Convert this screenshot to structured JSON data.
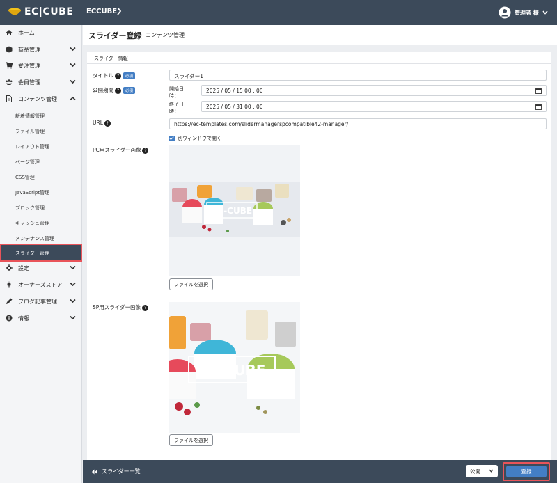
{
  "header": {
    "logo_text": "EC|CUBE",
    "site_name": "ECCUBE",
    "user_name": "管理者 様"
  },
  "sidebar": {
    "items": [
      {
        "label": "ホーム",
        "icon": "home-icon"
      },
      {
        "label": "商品管理",
        "icon": "cube-icon"
      },
      {
        "label": "受注管理",
        "icon": "cart-icon"
      },
      {
        "label": "会員管理",
        "icon": "users-icon"
      },
      {
        "label": "コンテンツ管理",
        "icon": "file-icon"
      }
    ],
    "content_sub_items": [
      "新着情報管理",
      "ファイル管理",
      "レイアウト管理",
      "ページ管理",
      "CSS管理",
      "JavaScript管理",
      "ブロック管理",
      "キャッシュ管理",
      "メンテナンス管理",
      "スライダー管理"
    ],
    "bottom_items": [
      {
        "label": "設定",
        "icon": "gear-icon"
      },
      {
        "label": "オーナーズストア",
        "icon": "plug-icon"
      },
      {
        "label": "ブログ記事管理",
        "icon": "pen-icon"
      },
      {
        "label": "情報",
        "icon": "info-icon"
      }
    ]
  },
  "page": {
    "title": "スライダー登録",
    "subtitle": "コンテンツ管理"
  },
  "form": {
    "section_title": "スライダー情報",
    "title_label": "タイトル",
    "required_badge": "必須",
    "title_value": "スライダー1",
    "period_label": "公開期間",
    "start_label_1": "開始日",
    "start_label_2": "時：",
    "start_value": "2025 / 05 / 15   00 : 00",
    "end_label_1": "終了日",
    "end_label_2": "時：",
    "end_value": "2025 / 05 / 31   00 : 00",
    "url_label": "URL",
    "url_value": "https://ec-templates.com/slidermanagerspcompatible42-manager/",
    "new_window_label": "別ウィンドウで開く",
    "pc_image_label": "PC用スライダー画像",
    "sp_image_label": "SP用スライダー画像",
    "file_button": "ファイルを選択",
    "image_text": "EC-CUBE"
  },
  "footer": {
    "back_label": "スライダー一覧",
    "status_value": "公開",
    "save_label": "登録"
  },
  "colors": {
    "header_bg": "#3c4a5a",
    "accent_blue": "#437ec4",
    "highlight_red": "#e9545a"
  }
}
